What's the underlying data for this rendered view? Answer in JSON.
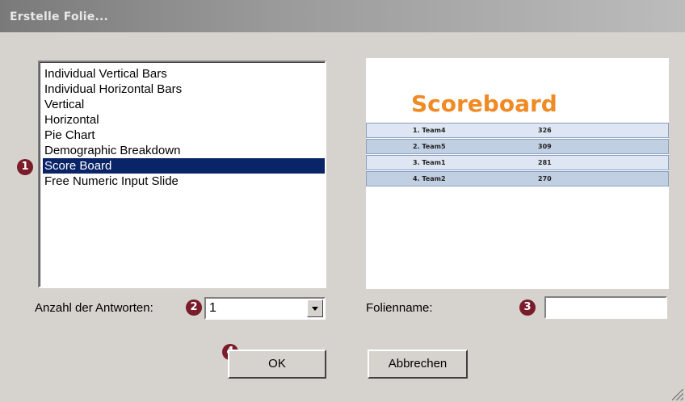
{
  "window": {
    "title": "Erstelle Folie..."
  },
  "slide_types": {
    "items": [
      {
        "label": "Individual Vertical Bars"
      },
      {
        "label": "Individual Horizontal Bars"
      },
      {
        "label": "Vertical"
      },
      {
        "label": "Horizontal"
      },
      {
        "label": "Pie Chart"
      },
      {
        "label": "Demographic Breakdown"
      },
      {
        "label": "Score Board",
        "selected": true
      },
      {
        "label": "Free Numeric Input Slide"
      }
    ]
  },
  "preview": {
    "title": "Scoreboard",
    "rows": [
      {
        "team": "1. Team4",
        "score": "326"
      },
      {
        "team": "2. Team5",
        "score": "309"
      },
      {
        "team": "3. Team1",
        "score": "281"
      },
      {
        "team": "4. Team2",
        "score": "270"
      }
    ]
  },
  "answers": {
    "label": "Anzahl der Antworten:",
    "value": "1"
  },
  "slide_name": {
    "label": "Folienname:",
    "value": ""
  },
  "buttons": {
    "ok": "OK",
    "cancel": "Abbrechen"
  },
  "badges": {
    "b1": "1",
    "b2": "2",
    "b3": "3",
    "b4": "4"
  },
  "colors": {
    "selection": "#0a2468",
    "badge": "#7a1c2a",
    "scoreboard_title": "#f08a24"
  }
}
